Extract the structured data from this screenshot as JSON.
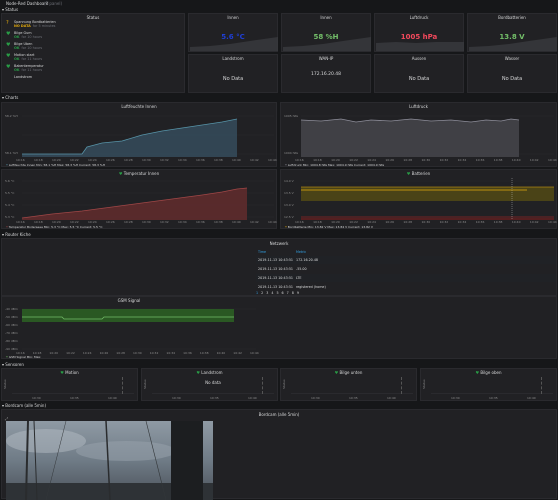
{
  "dashboard": {
    "title": "Node-Red Dashboard",
    "subtitle": "(1 panel)"
  },
  "rows": {
    "status": "Status",
    "charts": "Charts",
    "router": "Router Kiche",
    "sensoren": "Sensoren",
    "bordcam": "Bordcam (alle 5min)"
  },
  "status_panel": {
    "title": "Status",
    "items": [
      {
        "name": "Spannung Bordbatterien",
        "state": "NO DATA",
        "since": "for 5 minutes",
        "icon": "?",
        "color": "#e5ac0e"
      },
      {
        "name": "Bilge Gum",
        "state": "OK",
        "since": "for 10 hours",
        "icon": "♥",
        "color": "#299c46"
      },
      {
        "name": "Bilge Uben",
        "state": "OK",
        "since": "for 10 hours",
        "icon": "♥",
        "color": "#299c46"
      },
      {
        "name": "Motion start",
        "state": "OK",
        "since": "for 11 hours",
        "icon": "♥",
        "color": "#299c46"
      },
      {
        "name": "Bakentemperatur",
        "state": "OK",
        "since": "for 11 hours",
        "icon": "♥",
        "color": "#299c46"
      },
      {
        "name": "Landstrom",
        "state": "",
        "since": "",
        "icon": "",
        "color": "#299c46"
      }
    ]
  },
  "stats": [
    {
      "title": "Innen",
      "value": "5.6 °C",
      "color": "#1f3ed3"
    },
    {
      "title": "Innen",
      "value": "58 %H",
      "color": "#73bf69"
    },
    {
      "title": "Luftdruck",
      "value": "1005 hPa",
      "color": "#f2495c"
    },
    {
      "title": "Bordbatterien",
      "value": "13.8 V",
      "color": "#73bf69"
    },
    {
      "title": "Landstrom",
      "value": "No Data",
      "color": "#d8d9da"
    },
    {
      "title": "WAN-IP",
      "value": "172.16.20.48",
      "color": "#d8d9da"
    },
    {
      "title": "Aussen",
      "value": "No Data",
      "color": "#d8d9da"
    },
    {
      "title": "Wasser",
      "value": "No Data",
      "color": "#d8d9da"
    }
  ],
  "x_ticks": [
    "10:16",
    "10:18",
    "10:20",
    "10:22",
    "10:24",
    "10:26",
    "10:28",
    "10:30",
    "10:32",
    "10:34",
    "10:36",
    "10:38",
    "10:40",
    "10:42",
    "10:44"
  ],
  "charts": {
    "humidity": {
      "title": "Luftfeuchte Innen",
      "y_ticks": [
        "58.2 %H",
        "58.1 %H"
      ],
      "legend": "Luftfeuchte Innen Min: 58.1 %H  Max: 58.3 %H  Current: 58.3 %H"
    },
    "pressure": {
      "title": "Luftdruck",
      "y_ticks": [
        "1005 hPa",
        "1004 hPa"
      ],
      "legend": "Luftdruck Min: 1004.8 hPa  Max: 1004.9 hPa  Current: 1004.9 hPa"
    },
    "temperature": {
      "title": "Temperatur Innen",
      "y_ticks": [
        "5.6 °C",
        "5.5 °C",
        "5.4 °C",
        "5.3 °C"
      ],
      "legend": "Temperatur Boderseee Min: 5.3 °C  Max: 5.5 °C  Current: 5.5 °C"
    },
    "battery": {
      "title": "Batterien",
      "y_ticks": [
        "14.0 V",
        "13.5 V",
        "13.0 V",
        "12.5 V"
      ],
      "legend": "Bordbatterie Min: 13.82 V  Max: 13.84 V  Current: 13.82 V"
    }
  },
  "network": {
    "title": "Netzwerk",
    "col_time": "Time",
    "col_value": "Metric",
    "rows": [
      {
        "time": "2019-11-13 10:43:51",
        "value": "172.16.20.48"
      },
      {
        "time": "2019-11-13 10:43:51",
        "value": "-55.00"
      },
      {
        "time": "2019-11-13 10:43:51",
        "value": "LTE"
      },
      {
        "time": "2019-11-13 10:43:51",
        "value": "registered (home)"
      }
    ],
    "pages": [
      "1",
      "2",
      "3",
      "4",
      "5",
      "6",
      "7",
      "8",
      "9"
    ]
  },
  "gsm": {
    "title": "GSM Signal",
    "y_ticks": [
      "-40 dBm",
      "-50 dBm",
      "-60 dBm",
      "-70 dBm",
      "-80 dBm",
      "-90 dBm"
    ],
    "legend": "GSM Signal Min: Max:"
  },
  "sensors": [
    {
      "title": "Motion",
      "status_label": "Status",
      "nodata": "",
      "x_ticks": [
        "10:30",
        "10:35",
        "10:40"
      ]
    },
    {
      "title": "Landstrom",
      "status_label": "Status",
      "nodata": "No data",
      "x_ticks": [
        "10:30",
        "10:35",
        "10:40"
      ]
    },
    {
      "title": "Bilge unten",
      "status_label": "Status",
      "nodata": "",
      "x_ticks": [
        "10:30",
        "10:35",
        "10:40"
      ]
    },
    {
      "title": "Bilge oben",
      "status_label": "Status",
      "nodata": "",
      "x_ticks": [
        "10:30",
        "10:35",
        "10:40"
      ]
    }
  ],
  "bordcam": {
    "title": "Bordcam (alle 5min)"
  }
}
